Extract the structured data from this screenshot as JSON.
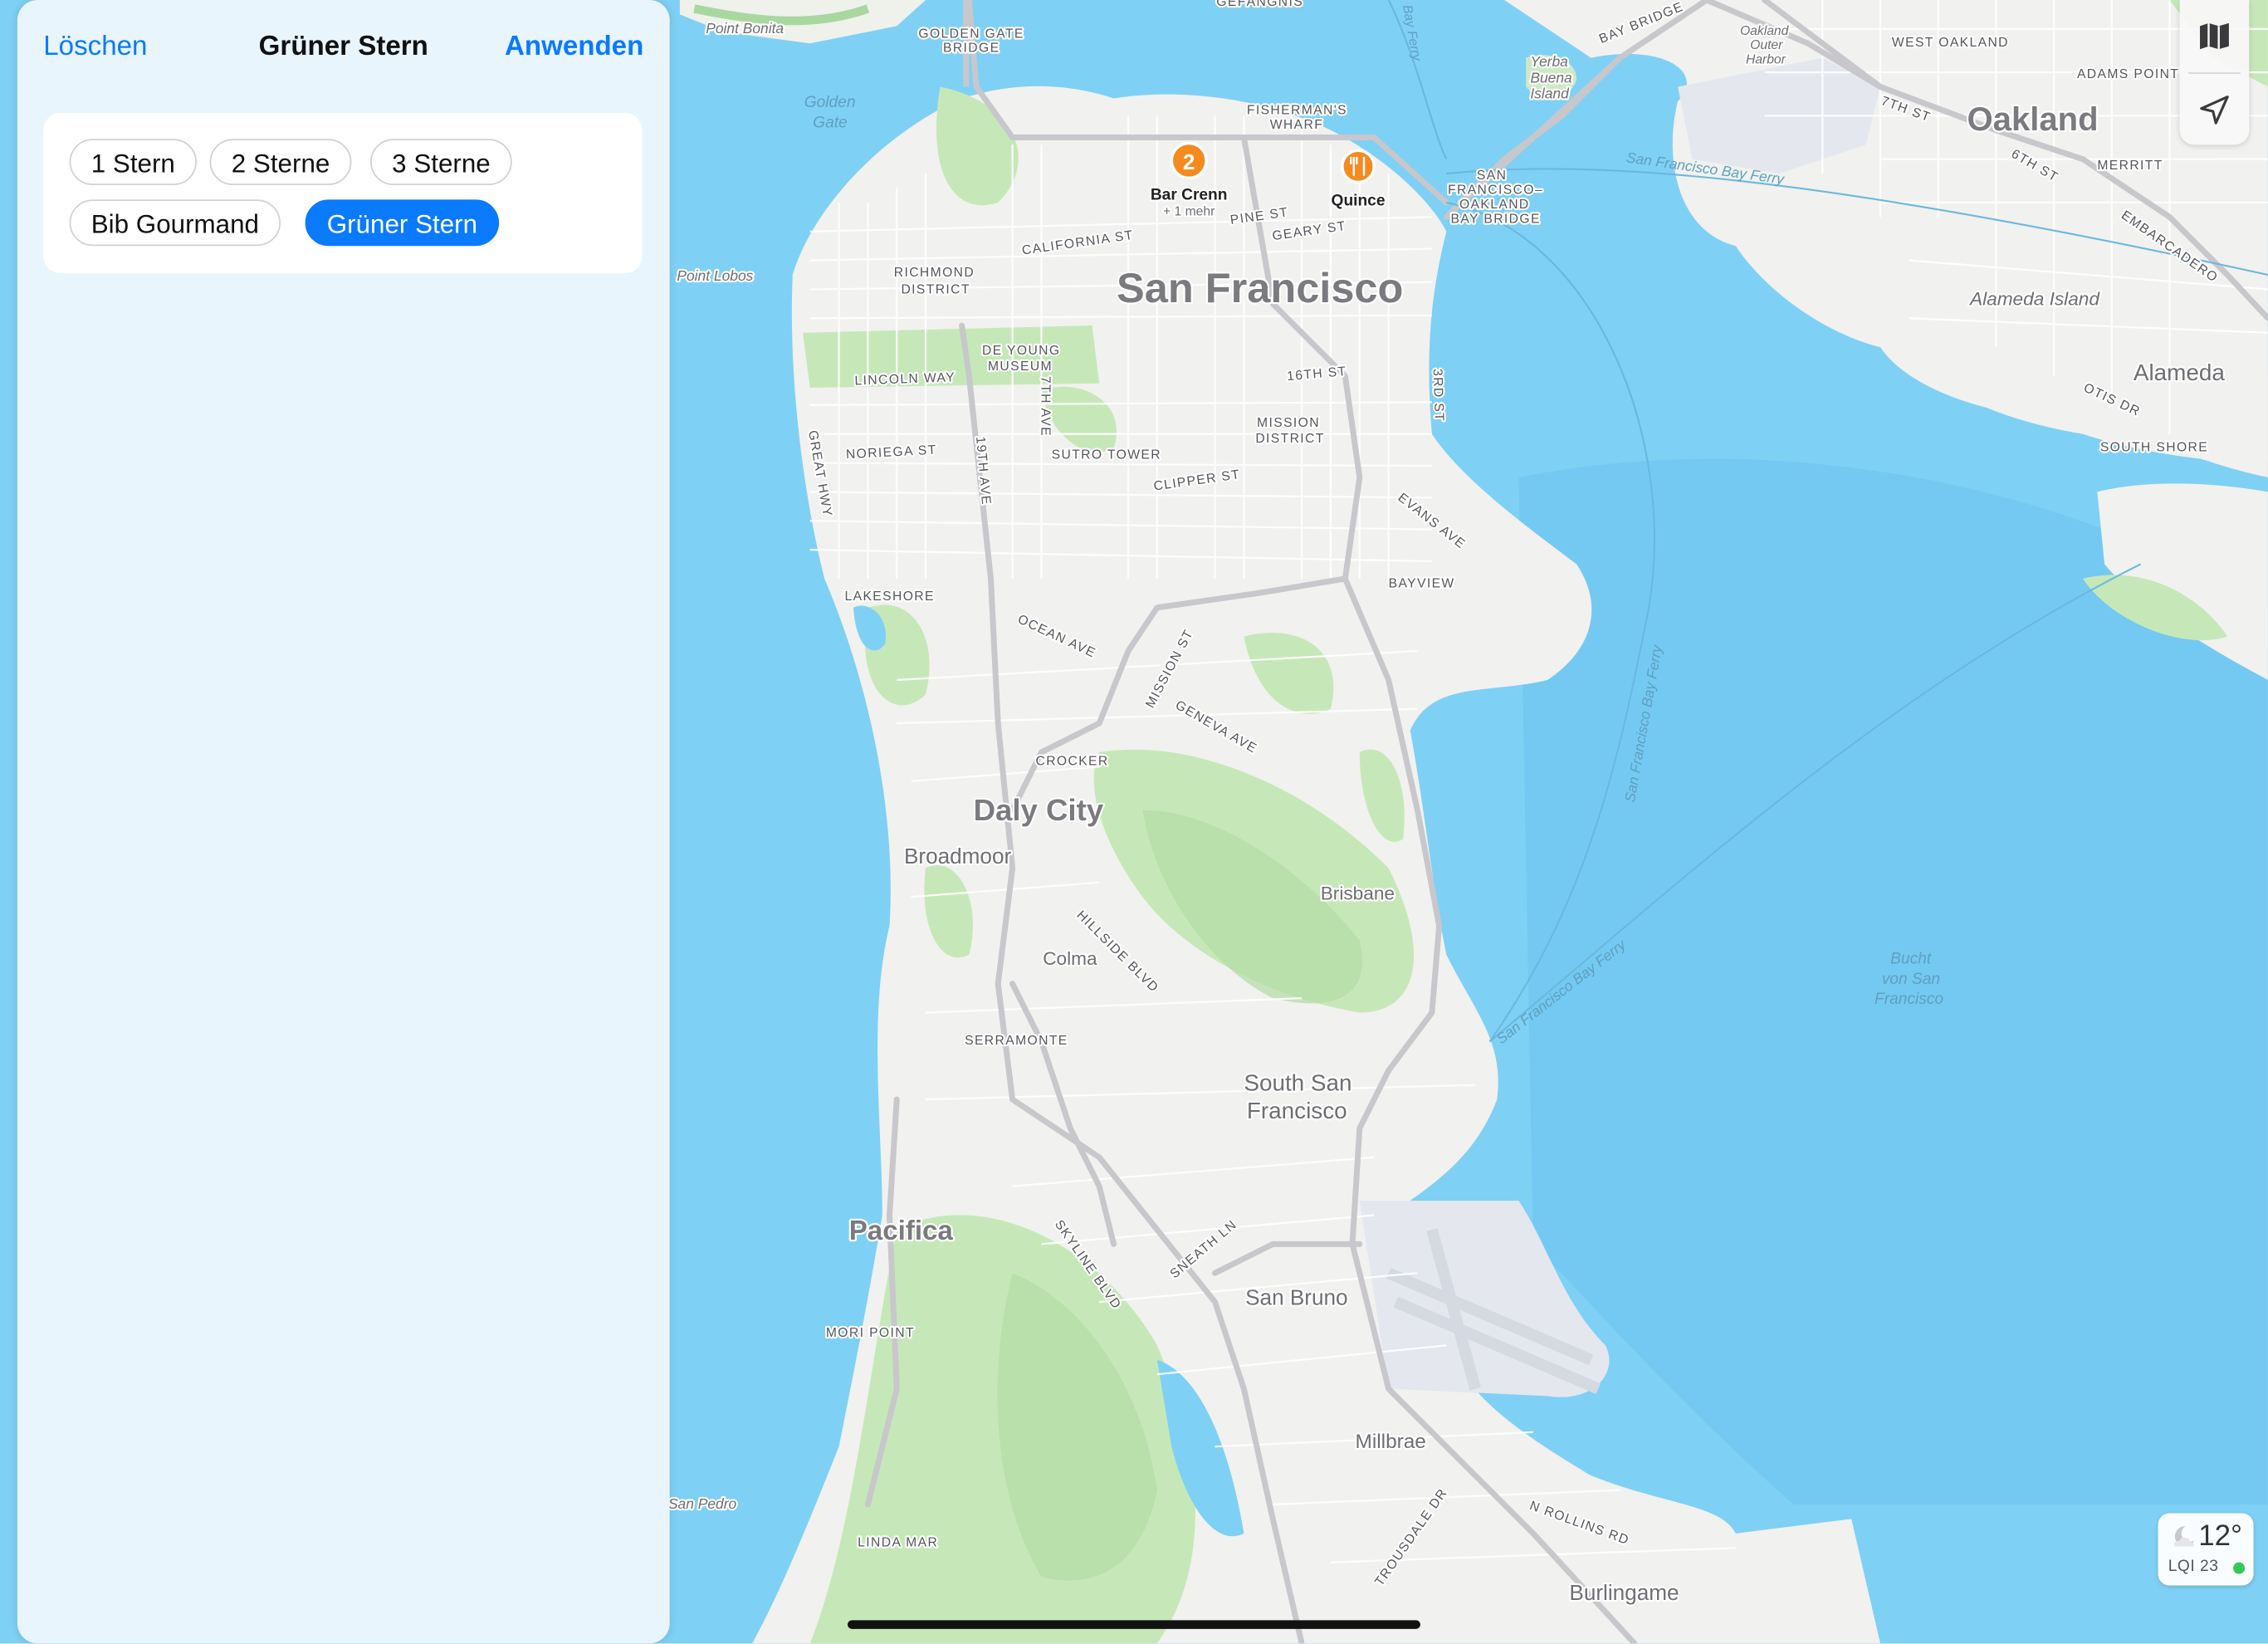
{
  "filter_panel": {
    "clear_label": "Löschen",
    "title": "Grüner Stern",
    "apply_label": "Anwenden",
    "chips": [
      {
        "label": "1 Stern",
        "selected": false
      },
      {
        "label": "2 Sterne",
        "selected": false
      },
      {
        "label": "3 Sterne",
        "selected": false
      },
      {
        "label": "Bib Gourmand",
        "selected": false
      },
      {
        "label": "Grüner Stern",
        "selected": true
      }
    ]
  },
  "map_controls": {
    "map_mode_icon": "map-icon",
    "location_icon": "location-arrow-icon"
  },
  "weather": {
    "icon": "moon-cloud-icon",
    "temperature": "12°",
    "aqi": "LQI 23",
    "aqi_color": "#34c759"
  },
  "pins": {
    "cluster": {
      "count": "2",
      "label": "Bar Crenn",
      "sublabel": "+ 1 mehr",
      "color": "#f58a1f"
    },
    "quince": {
      "label": "Quince",
      "icon": "fork-knife-icon",
      "color": "#f58a1f"
    }
  },
  "map_labels": {
    "san_francisco": "San Francisco",
    "oakland": "Oakland",
    "alameda": "Alameda",
    "alameda_island": "Alameda Island",
    "daly_city": "Daly City",
    "broadmoor": "Broadmoor",
    "brisbane": "Brisbane",
    "colma": "Colma",
    "south_sf_1": "South San",
    "south_sf_2": "Francisco",
    "pacifica": "Pacifica",
    "san_bruno": "San Bruno",
    "millbrae": "Millbrae",
    "burlingame": "Burlingame",
    "golden_gate_1": "Golden",
    "golden_gate_2": "Gate",
    "golden_gate_bridge_1": "GOLDEN GATE",
    "golden_gate_bridge_2": "BRIDGE",
    "point_bonita": "Point Bonita",
    "point_lobos": "Point Lobos",
    "richmond_1": "RICHMOND",
    "richmond_2": "DISTRICT",
    "de_young_1": "DE YOUNG",
    "de_young_2": "MUSEUM",
    "fishermans_1": "FISHERMAN'S",
    "fishermans_2": "WHARF",
    "sf_bay_bridge_1": "SAN",
    "sf_bay_bridge_2": "FRANCISCO–",
    "sf_bay_bridge_3": "OAKLAND",
    "sf_bay_bridge_4": "BAY BRIDGE",
    "yerba_1": "Yerba",
    "yerba_2": "Buena",
    "yerba_3": "Island",
    "bay_bridge": "BAY BRIDGE",
    "oakland_outer_1": "Oakland",
    "oakland_outer_2": "Outer",
    "oakland_outer_3": "Harbor",
    "west_oakland": "WEST OAKLAND",
    "adams_point": "ADAMS POINT",
    "merritt": "MERRITT",
    "embarcadero": "EMBARCADERO",
    "seventh_st_oak": "7TH ST",
    "sixth_st": "6TH ST",
    "otis_dr": "OTIS DR",
    "south_shore": "SOUTH SHORE",
    "sf_bay_ferry_1": "San Francisco Bay Ferry",
    "sf_bay_ferry_2": "San Francisco Bay Ferry",
    "sf_bay_ferry_3": "San Francisco Bay Ferry",
    "bucht_1": "Bucht",
    "bucht_2": "von San",
    "bucht_3": "Francisco",
    "california_st": "CALIFORNIA ST",
    "pine_st": "PINE ST",
    "geary_st": "GEARY ST",
    "lincoln_way": "LINCOLN WAY",
    "noriega_st": "NORIEGA ST",
    "great_hwy": "GREAT HWY",
    "nineteenth_ave": "19TH AVE",
    "seventh_ave": "7TH AVE",
    "sutro_tower": "SUTRO TOWER",
    "sixteenth_st": "16TH ST",
    "mission_1": "MISSION",
    "mission_2": "DISTRICT",
    "third_st": "3RD ST",
    "clipper_st": "CLIPPER ST",
    "evans_ave": "EVANS AVE",
    "bayview": "BAYVIEW",
    "lakeshore": "LAKESHORE",
    "ocean_ave": "OCEAN AVE",
    "mission_st": "MISSION ST",
    "geneva_ave": "GENEVA AVE",
    "crocker": "CROCKER",
    "hillside_blvd": "HILLSIDE BLVD",
    "serramonte": "SERRAMONTE",
    "skyline_blvd": "SKYLINE BLVD",
    "sneath_ln": "SNEATH LN",
    "mori_point": "MORI POINT",
    "san_pedro": "San Pedro",
    "linda_mar": "LINDA MAR",
    "trousdale_dr": "TROUSDALE DR",
    "n_rollins_rd": "N ROLLINS RD",
    "gefangnis": "GEFÄNGNIS",
    "bay_ferry_top": "Bay Ferry"
  }
}
